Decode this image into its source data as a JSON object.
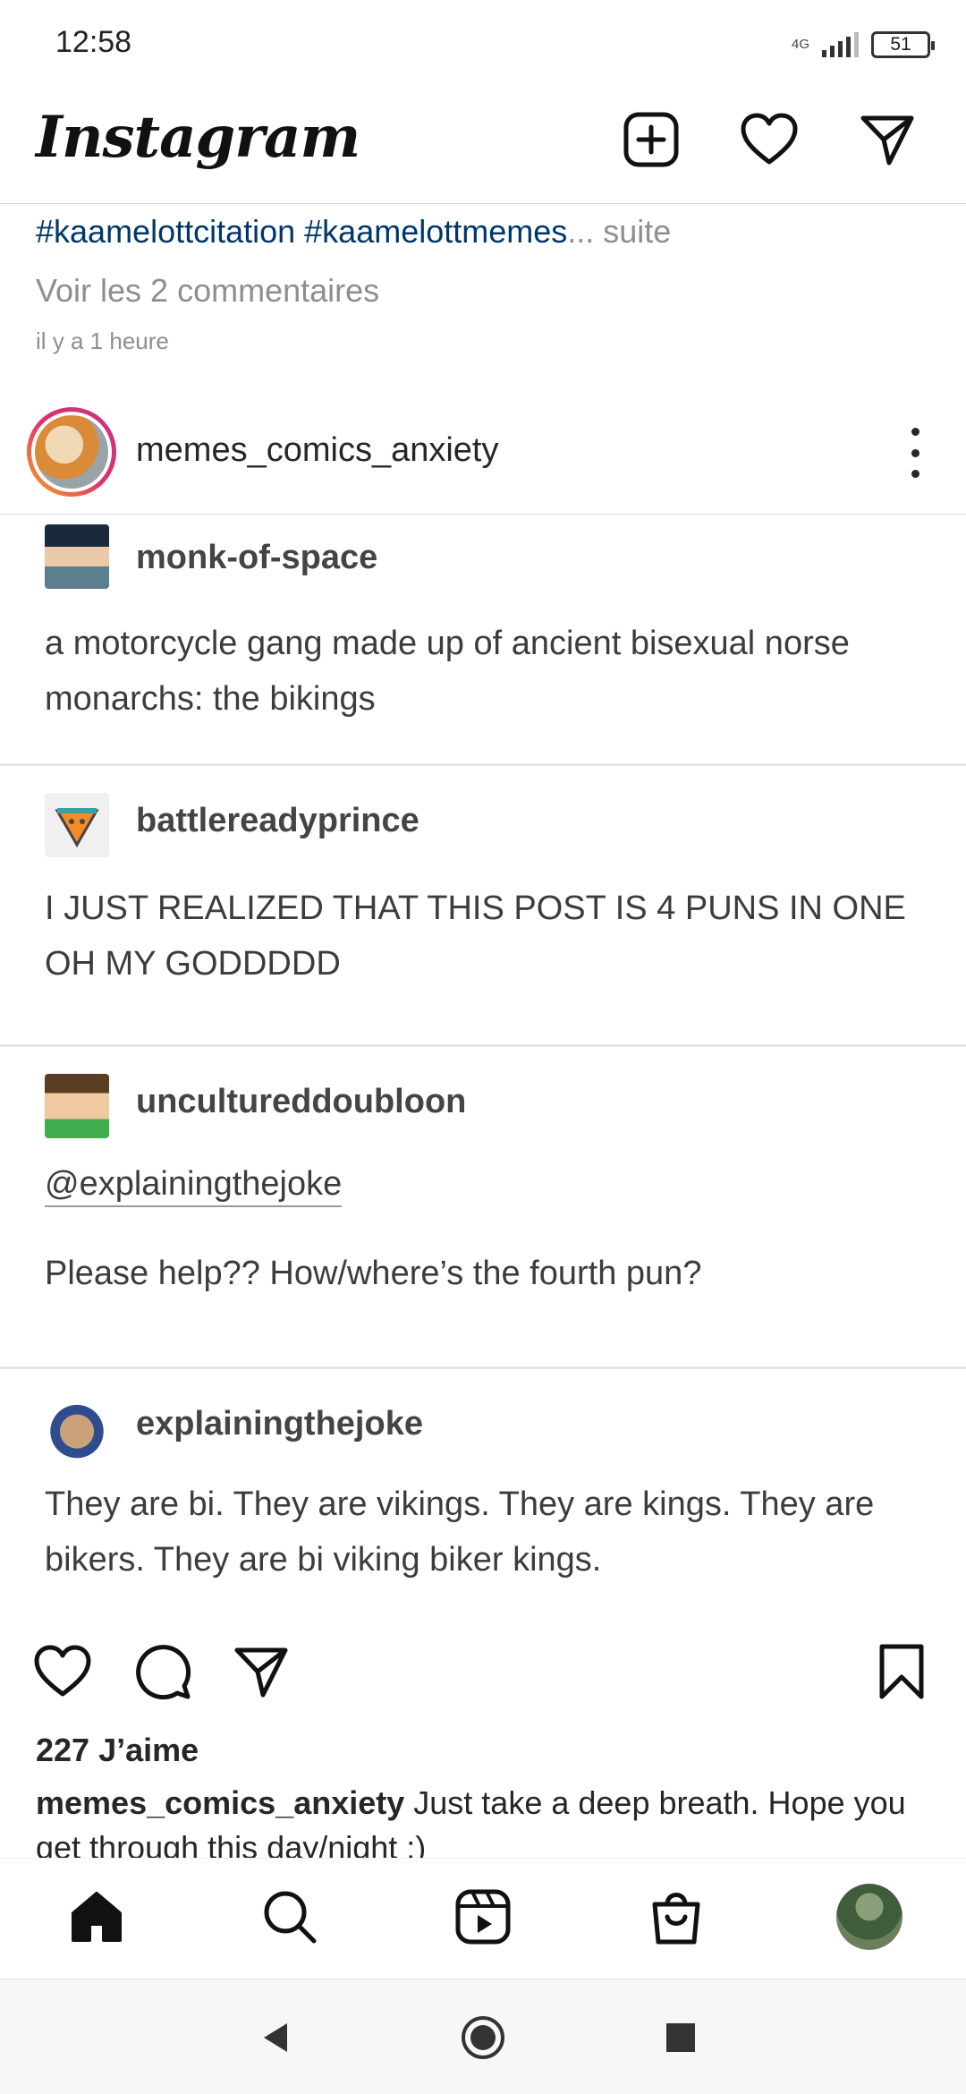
{
  "status_bar": {
    "time": "12:58",
    "network": "4G",
    "battery": "51"
  },
  "header": {
    "logo": "Instagram",
    "icons": [
      "add-post-icon",
      "heart-icon",
      "direct-message-icon"
    ]
  },
  "previous_post": {
    "hashtags": "#kaamelottcitation #kaamelottmemes",
    "more": "... suite",
    "comments_link": "Voir les 2 commentaires",
    "timestamp": "il y a 1 heure"
  },
  "post": {
    "username": "memes_comics_anxiety",
    "tumblr": [
      {
        "user": "monk-of-space",
        "text": "a motorcycle gang made up of ancient bisexual norse monarchs: the bikings"
      },
      {
        "user": "battlereadyprince",
        "text": "I JUST REALIZED THAT THIS POST IS 4 PUNS IN ONE OH MY GODDDDD"
      },
      {
        "user": "uncultureddoubloon",
        "mention": "@explainingthejoke",
        "text": "Please help?? How/where’s the fourth pun?"
      },
      {
        "user": "explainingthejoke",
        "text": "They are bi. They are vikings. They are kings. They are bikers. They are bi viking biker kings."
      }
    ],
    "likes": "227 J’aime",
    "caption_user": "memes_comics_anxiety",
    "caption_text": "Just take a deep breath. Hope you get through this day/night :)"
  },
  "bottom_nav": [
    "home-icon",
    "search-icon",
    "reels-icon",
    "shop-icon",
    "profile-avatar"
  ],
  "colors": {
    "link": "#00376b",
    "muted": "#8e8e8e",
    "text": "#262626"
  }
}
